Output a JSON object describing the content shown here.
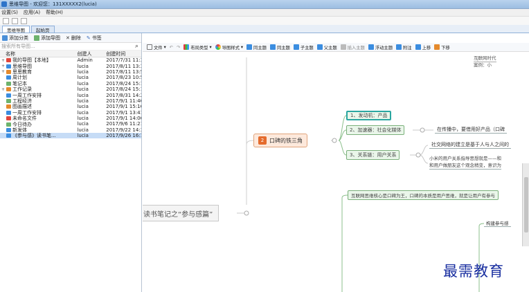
{
  "window": {
    "title": "思维导图 - 欢迎您：131XXXXX2(lucia)"
  },
  "menu": [
    "设置(S)",
    "应用(A)",
    "帮助(H)"
  ],
  "tabs": [
    {
      "label": "思维导图",
      "active": true
    },
    {
      "label": "起始页",
      "active": false
    }
  ],
  "left_toolbar": {
    "add_category": "添加分类",
    "add_map": "添加导图",
    "delete": "删除",
    "bookmark": "书签"
  },
  "search": {
    "placeholder": "搜索所有导图..."
  },
  "table": {
    "headers": [
      "名称",
      "创建人",
      "创建时间"
    ],
    "rows": [
      {
        "name": "我的导图【本地】",
        "creator": "Admin",
        "time": "2017/7/31 11:3",
        "expander": "+"
      },
      {
        "name": "思维导图",
        "creator": "lucia",
        "time": "2017/8/11 13:3",
        "expander": "+"
      },
      {
        "name": "思思教育",
        "creator": "lucia",
        "time": "2017/8/11 13:5",
        "expander": "+"
      },
      {
        "name": "周计划",
        "creator": "lucia",
        "time": "2017/8/23 10:5",
        "expander": ""
      },
      {
        "name": "笔记本",
        "creator": "lucia",
        "time": "2017/8/24 15:1",
        "expander": ""
      },
      {
        "name": "工作记录",
        "creator": "lucia",
        "time": "2017/8/24 15:1",
        "expander": "+"
      },
      {
        "name": "一周工作安排",
        "creator": "lucia",
        "time": "2017/8/31 14:2",
        "expander": ""
      },
      {
        "name": "工程经济",
        "creator": "lucia",
        "time": "2017/9/1 11:46",
        "expander": ""
      },
      {
        "name": "图画描述",
        "creator": "lucia",
        "time": "2017/9/1 15:16",
        "expander": ""
      },
      {
        "name": "一周工作安排",
        "creator": "lucia",
        "time": "2017/9/1 13:41",
        "expander": ""
      },
      {
        "name": "未命名文件",
        "creator": "lucia",
        "time": "2017/9/1 14:06",
        "expander": ""
      },
      {
        "name": "今日待办",
        "creator": "lucia",
        "time": "2017/9/6 11:21",
        "expander": ""
      },
      {
        "name": "新发体",
        "creator": "lucia",
        "time": "2017/9/22 14:3",
        "expander": ""
      },
      {
        "name": "《参与感》读书笔...",
        "creator": "lucia",
        "time": "2017/9/26 16:1",
        "expander": "",
        "selected": true
      }
    ]
  },
  "right_toolbar": {
    "file": "文件",
    "layout": "布局类型",
    "style": "导图样式",
    "sibling_topic": "同主题",
    "same_topic": "同主题",
    "child_topic": "子主题",
    "parent_topic": "父主题",
    "insert_topic": "插入主题",
    "float_topic": "浮动主题",
    "note": "附注",
    "move_up": "上移",
    "move_down": "下移"
  },
  "mindmap": {
    "root": "读书笔记之“参与感篇”",
    "center_index": "2",
    "center": "口碑的铁三角",
    "subs": [
      "1、发动机：产品",
      "2、加速器：社会化媒体",
      "3、关系链：用户关系"
    ],
    "leaf_media": "在传播中，要借用好产品（口碑",
    "leaf_social": "社交网络的建立是基于人与人之间的",
    "leaf_xiaomi_1": "小米的用户关系指导思想就是——和",
    "leaf_xiaomi_2": "和用户做朋友这个观念稍变，意识为",
    "top_box_1": "互联网时代",
    "top_box_2": "案例：小",
    "core": "互联网思维核心是口碑为王，口碑的本质是用户思维，就是让用户有参与",
    "build": "构建参与感"
  },
  "watermark": "最需教育"
}
